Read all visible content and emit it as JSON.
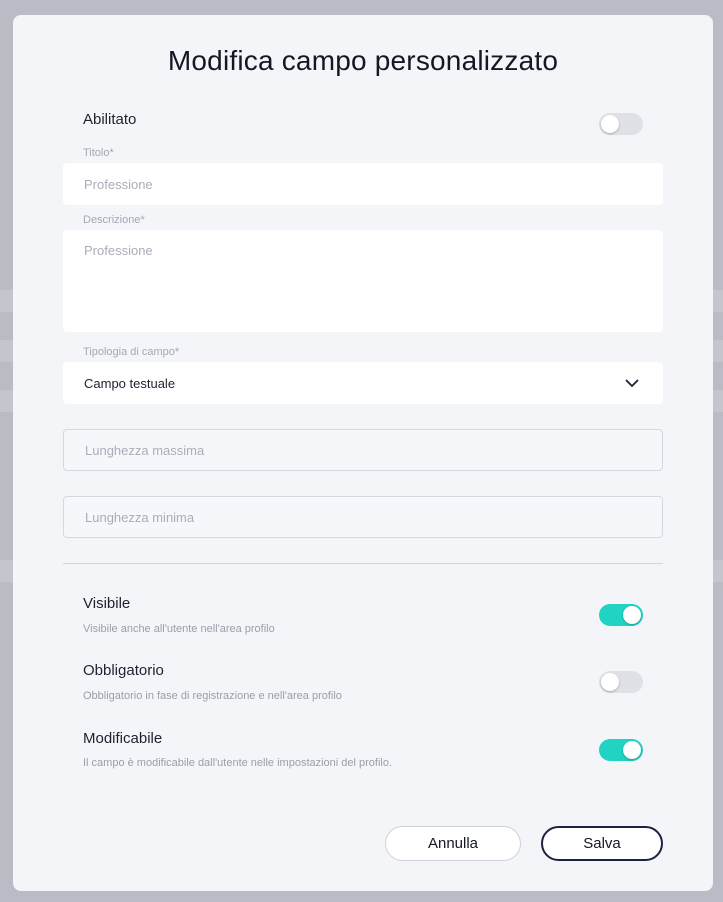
{
  "modal": {
    "title": "Modifica campo personalizzato",
    "enabled": {
      "label": "Abilitato",
      "on": false
    },
    "title_field": {
      "label": "Titolo*",
      "placeholder": "Professione"
    },
    "description_field": {
      "label": "Descrizione*",
      "placeholder": "Professione"
    },
    "field_type": {
      "label": "Tipologia di campo*",
      "value": "Campo testuale",
      "icon": "chevron-down-icon"
    },
    "max_length": {
      "placeholder": "Lunghezza massima"
    },
    "min_length": {
      "placeholder": "Lunghezza minima"
    },
    "visible": {
      "label": "Visibile",
      "description": "Visibile anche all'utente nell'area profilo",
      "on": true
    },
    "required": {
      "label": "Obbligatorio",
      "description": "Obbligatorio in fase di registrazione e nell'area profilo",
      "on": false
    },
    "editable": {
      "label": "Modificabile",
      "description": "Il campo è modificabile dall'utente nelle impostazioni del profilo.",
      "on": true
    },
    "cancel_label": "Annulla",
    "save_label": "Salva"
  },
  "colors": {
    "accent": "#21d3c2",
    "toggle_off": "#dfe1e7",
    "primary_border": "#1a2240"
  }
}
